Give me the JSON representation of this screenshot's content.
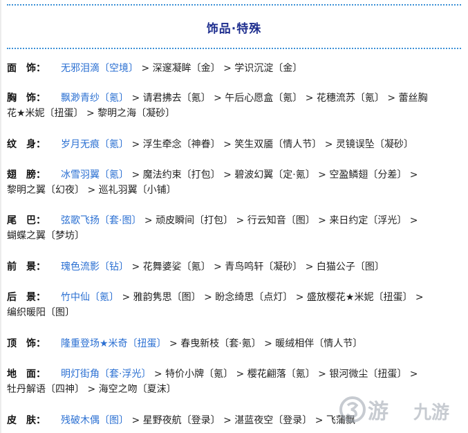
{
  "title": "饰品·特殊",
  "rows": [
    {
      "label": "面　饰：",
      "first": "无邪泪滴〔空境〕",
      "rest": " > 深邃凝眸〔金〕 > 学识沉淀〔金〕",
      "line2": ""
    },
    {
      "label": "胸　饰：",
      "first": "飘渺青纱〔氪〕",
      "rest": " > 请君拂去〔氪〕 > 午后心愿盒〔氪〕 > 花穗流苏〔氪〕 > 蕾丝胸",
      "line2": "花★米妮〔扭蛋〕 > 黎明之海〔凝砂〕"
    },
    {
      "label": "纹　身：",
      "first": "岁月无痕〔氪〕",
      "rest": " > 浮生牵念〔神眷〕 > 笑生双靥〔情人节〕 > 灵镜误坠〔凝砂〕",
      "line2": ""
    },
    {
      "label": "翅　膀：",
      "first": "冰雪羽翼〔氪〕",
      "rest": " > 魔法约束〔打包〕 > 碧波幻翼〔定·氪〕 > 空盈鳞翅〔分差〕 >",
      "line2": "黎明之翼〔幻夜〕 > 巡礼羽翼〔小铺〕"
    },
    {
      "label": "尾　巴：",
      "first": "弦歌飞扬〔套·图〕",
      "rest": " > 顽皮瞬间〔打包〕 > 行云知音〔图〕 > 来日约定〔浮光〕 >",
      "line2": "蝴蝶之翼〔梦坊〕"
    },
    {
      "label": "前　景：",
      "first": "瑰色流影〔钻〕",
      "rest": " > 花舞婆娑〔氪〕 > 青鸟鸣轩〔凝砂〕 > 白猫公子〔图〕",
      "line2": ""
    },
    {
      "label": "后　景：",
      "first": "竹中仙〔氪〕",
      "rest": " > 雅韵隽思〔图〕 > 盼念绮思〔点灯〕 > 盛放樱花★米妮〔扭蛋〕 >",
      "line2": "编织暖阳〔图〕"
    },
    {
      "label": "顶　饰：",
      "first": "隆重登场★米奇〔扭蛋〕",
      "rest": " > 春曳新枝〔套·氪〕 > 暖绒相伴〔情人节〕",
      "line2": ""
    },
    {
      "label": "地　面：",
      "first": "明灯街角〔套·浮光〕",
      "rest": " > 特价小牌〔氪〕 > 樱花翩落〔氪〕 > 银河微尘〔扭蛋〕 >",
      "line2": "牡丹解语〔四神〕 > 海空之吻〔夏沫〕"
    },
    {
      "label": "皮　肤：",
      "first": "残破木偶〔图〕",
      "rest": " > 星野夜航〔登录〕 > 湛蓝夜空〔登录〕 > 飞蒲飘",
      "line2": ""
    }
  ],
  "watermark": {
    "text": "游",
    "text2": "九游",
    "color": "#9aa2ad"
  },
  "colors": {
    "title": "#1f2f8f",
    "link": "#2a6fd2",
    "divider": "#3a8fd6"
  }
}
